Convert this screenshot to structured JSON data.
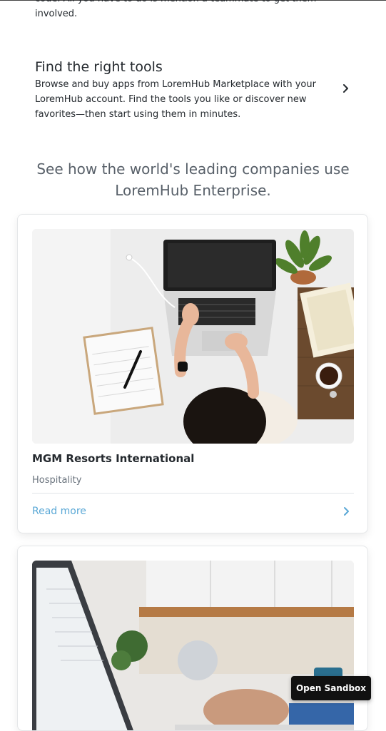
{
  "intro": {
    "tail_line1": "code. All you have to do is mention a teammate to get them",
    "tail_line2": "involved."
  },
  "tools": {
    "title": "Find the right tools",
    "description": "Browse and buy apps from LoremHub Marketplace with your LoremHub account. Find the tools you like or discover new favorites—then start using them in minutes.",
    "chevron_icon": "chevron-right-icon"
  },
  "companies": {
    "heading": "See how the world's leading companies use LoremHub Enterprise."
  },
  "cards": [
    {
      "title": "MGM Resorts International",
      "industry": "Hospitality",
      "link_label": "Read more",
      "image": "desk-laptop-photo"
    },
    {
      "image": "laptop-office-photo"
    }
  ],
  "sandbox": {
    "label": "Open Sandbox"
  },
  "colors": {
    "link": "#5aa8d6",
    "text": "#24292e",
    "muted": "#586069",
    "button_bg": "#111111"
  }
}
